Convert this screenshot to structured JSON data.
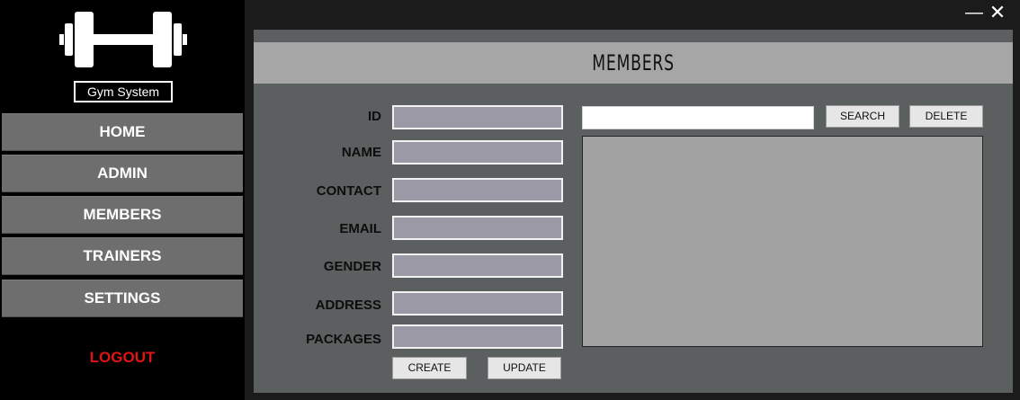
{
  "brand": {
    "name": "Gym System",
    "logo_icon": "dumbbell-icon"
  },
  "nav": {
    "items": [
      {
        "label": "HOME"
      },
      {
        "label": "ADMIN"
      },
      {
        "label": "MEMBERS"
      },
      {
        "label": "TRAINERS"
      },
      {
        "label": "SETTINGS"
      }
    ],
    "logout": "LOGOUT"
  },
  "window": {
    "minimize": "—",
    "close": "✕"
  },
  "page": {
    "title": "MEMBERS"
  },
  "form": {
    "fields": [
      {
        "label": "ID",
        "value": ""
      },
      {
        "label": "NAME",
        "value": ""
      },
      {
        "label": "CONTACT",
        "value": ""
      },
      {
        "label": "EMAIL",
        "value": ""
      },
      {
        "label": "GENDER",
        "value": ""
      },
      {
        "label": "ADDRESS",
        "value": ""
      },
      {
        "label": "PACKAGES",
        "value": ""
      }
    ],
    "create": "CREATE",
    "update": "UPDATE"
  },
  "search": {
    "value": "",
    "button": "SEARCH",
    "delete": "DELETE"
  },
  "colors": {
    "sidebar": "#000000",
    "nav_item": "#6e6e6e",
    "logout": "#e01414",
    "panel": "#5c5f5f",
    "header": "#a6a6a6",
    "field": "#9a99a5"
  }
}
